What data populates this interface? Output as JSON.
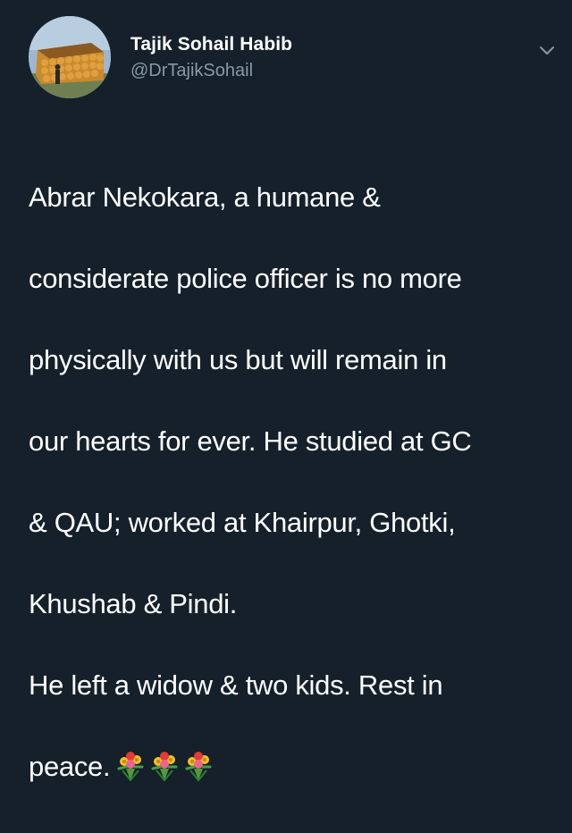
{
  "tweet": {
    "author_name": "Tajik Sohail Habib",
    "author_handle": "@DrTajikSohail",
    "lines": [
      "Abrar Nekokara, a humane &",
      "considerate police officer is no more",
      "physically with us but will remain in",
      "our hearts for ever. He studied at GC",
      "& QAU; worked at Khairpur, Ghotki,",
      "Khushab & Pindi.",
      "He left a widow & two kids. Rest in",
      "peace."
    ],
    "emoji": [
      "bouquet-emoji",
      "bouquet-emoji",
      "bouquet-emoji"
    ],
    "icons": {
      "caret": "chevron-down-icon",
      "avatar": "avatar-image"
    },
    "colors": {
      "background": "#15202b",
      "text": "#ffffff",
      "secondary_text": "#8899a6"
    }
  }
}
